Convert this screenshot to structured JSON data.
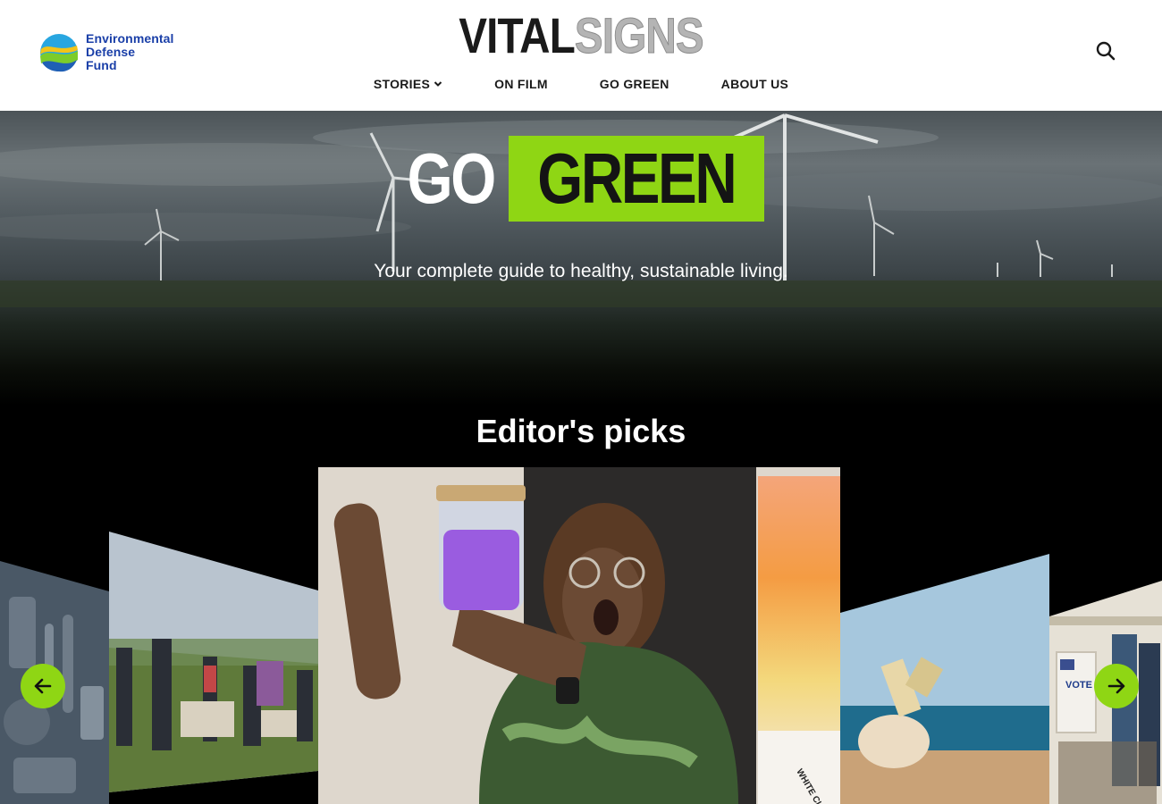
{
  "header": {
    "org_logo": {
      "line1": "Environmental",
      "line2": "Defense",
      "line3": "Fund"
    },
    "brand": {
      "part1": "VITAL",
      "part2": "SIGNS"
    },
    "nav": [
      {
        "label": "STORIES",
        "has_dropdown": true
      },
      {
        "label": "ON FILM"
      },
      {
        "label": "GO GREEN"
      },
      {
        "label": "ABOUT US"
      }
    ],
    "search_icon": "search-icon"
  },
  "hero": {
    "title_part1": "GO",
    "title_part2": "GREEN",
    "subtitle": "Your complete guide to healthy, sustainable living.",
    "accent_color": "#8fd614"
  },
  "picks": {
    "title": "Editor's picks",
    "cards": [
      {
        "subject": "plastic utensils and containers"
      },
      {
        "subject": "yard sale"
      },
      {
        "subject": "woman holding purple jar",
        "sign_text": "WHITE CLAW"
      },
      {
        "subject": "person on beach with hat"
      },
      {
        "subject": "voting booths",
        "sign_text": "VOTE"
      }
    ],
    "prev_icon": "arrow-left-icon",
    "next_icon": "arrow-right-icon"
  }
}
